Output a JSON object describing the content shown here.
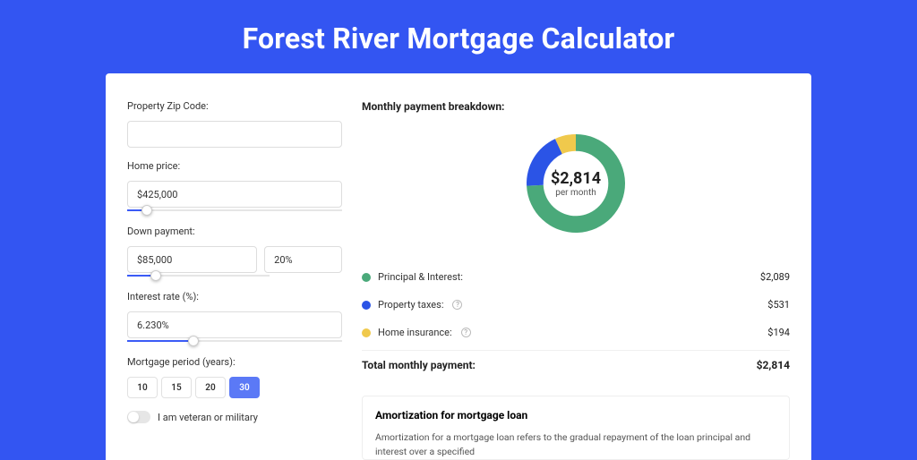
{
  "title": "Forest River Mortgage Calculator",
  "colors": {
    "green": "#4aa97a",
    "blue": "#2b54e6",
    "yellow": "#f0c94c"
  },
  "form": {
    "zip_label": "Property Zip Code:",
    "zip_value": "",
    "home_price_label": "Home price:",
    "home_price_value": "$425,000",
    "home_price_slider_pct": 9,
    "down_payment_label": "Down payment:",
    "down_payment_value": "$85,000",
    "down_payment_pct_value": "20%",
    "down_payment_slider_pct": 20,
    "interest_label": "Interest rate (%):",
    "interest_value": "6.230%",
    "interest_slider_pct": 31,
    "period_label": "Mortgage period (years):",
    "periods": [
      "10",
      "15",
      "20",
      "30"
    ],
    "period_selected_index": 3,
    "veteran_label": "I am veteran or military"
  },
  "breakdown": {
    "heading": "Monthly payment breakdown:",
    "center_amount": "$2,814",
    "center_sub": "per month",
    "items": [
      {
        "label": "Principal & Interest:",
        "value": "$2,089",
        "dot": "green",
        "info": false
      },
      {
        "label": "Property taxes:",
        "value": "$531",
        "dot": "blue",
        "info": true
      },
      {
        "label": "Home insurance:",
        "value": "$194",
        "dot": "yellow",
        "info": true
      }
    ],
    "total_label": "Total monthly payment:",
    "total_value": "$2,814"
  },
  "amortization": {
    "title": "Amortization for mortgage loan",
    "text": "Amortization for a mortgage loan refers to the gradual repayment of the loan principal and interest over a specified"
  },
  "chart_data": {
    "type": "pie",
    "title": "Monthly payment breakdown",
    "series": [
      {
        "name": "Principal & Interest",
        "value": 2089,
        "color": "#4aa97a"
      },
      {
        "name": "Property taxes",
        "value": 531,
        "color": "#2b54e6"
      },
      {
        "name": "Home insurance",
        "value": 194,
        "color": "#f0c94c"
      }
    ],
    "total": 2814,
    "inner_radius_ratio": 0.66
  }
}
